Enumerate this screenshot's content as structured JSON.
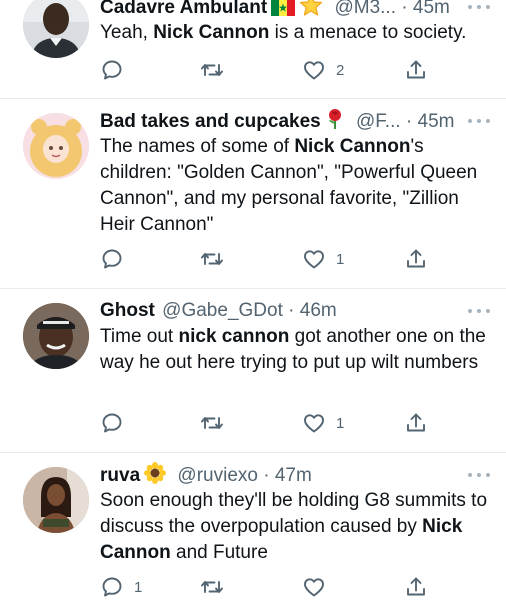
{
  "tweets": [
    {
      "name": "Cadavre Ambulant",
      "badges": [
        "senegal-flag",
        "star"
      ],
      "handle": "@M3...",
      "time": "45m",
      "body_pre": "Yeah, ",
      "body_bold": "Nick Cannon",
      "body_post": " is a menace to society.",
      "reply_count": "",
      "retweet_count": "",
      "like_count": "2"
    },
    {
      "name": "Bad takes and cupcakes",
      "badges": [
        "rose"
      ],
      "handle": "@F...",
      "time": "45m",
      "body_pre": "The names of some of ",
      "body_bold": "Nick Cannon",
      "body_post": "'s children: \"Golden Cannon\", \"Powerful Queen Cannon\", and my personal favorite, \"Zillion Heir Cannon\"",
      "reply_count": "",
      "retweet_count": "",
      "like_count": "1"
    },
    {
      "name": "Ghost",
      "badges": [],
      "handle": "@Gabe_GDot",
      "time": "46m",
      "body_pre": "Time out ",
      "body_bold": "nick cannon",
      "body_post": " got another one on the way he out here trying to put up wilt numbers",
      "reply_count": "",
      "retweet_count": "",
      "like_count": "1"
    },
    {
      "name": "ruva",
      "badges": [
        "sunflower"
      ],
      "handle": "@ruviexo",
      "time": "47m",
      "body_pre": "Soon enough they'll be holding G8 summits to discuss the overpopulation caused by ",
      "body_bold": "Nick Cannon",
      "body_post": " and Future",
      "reply_count": "1",
      "retweet_count": "",
      "like_count": ""
    }
  ],
  "separator": "·",
  "colors": {
    "text": "#0f1419",
    "meta": "#536471",
    "divider": "#e6ecf0",
    "icon": "#536471"
  },
  "icons": {
    "reply": "reply-icon",
    "retweet": "retweet-icon",
    "like": "heart-icon",
    "share": "share-icon",
    "more": "more-icon"
  }
}
